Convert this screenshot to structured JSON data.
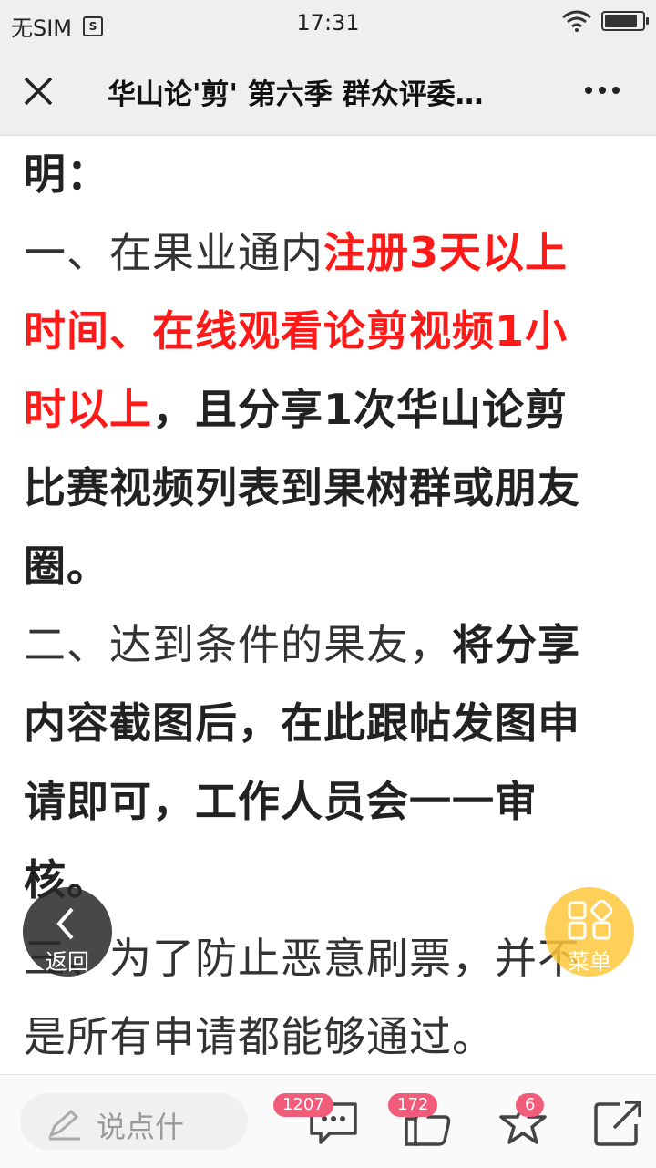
{
  "status_bar": {
    "carrier": "无SIM",
    "time": "17:31"
  },
  "nav": {
    "title": "华山论'剪' 第六季 群众评委…"
  },
  "article": {
    "lines": [
      [
        {
          "t": "明：",
          "s": "b"
        }
      ],
      [
        {
          "t": "一、在果业通内",
          "s": "n"
        },
        {
          "t": "注册3天以上",
          "s": "r"
        }
      ],
      [
        {
          "t": "时间、在线观看论剪视频1小",
          "s": "r"
        }
      ],
      [
        {
          "t": "时以上",
          "s": "r"
        },
        {
          "t": "，且分享1次华山论剪",
          "s": "b"
        }
      ],
      [
        {
          "t": "比赛视频列表到果树群或朋友",
          "s": "b"
        }
      ],
      [
        {
          "t": "圈。",
          "s": "b"
        }
      ],
      [
        {
          "t": "二、达到条件的果友，",
          "s": "n"
        },
        {
          "t": "将分享",
          "s": "b"
        }
      ],
      [
        {
          "t": "内容截图后，在此跟帖发图申",
          "s": "b"
        }
      ],
      [
        {
          "t": "请即可，工作人员会一一审",
          "s": "b"
        }
      ],
      [
        {
          "t": "核。",
          "s": "b"
        }
      ],
      [
        {
          "t": "三、为了防止恶意刷票，并不",
          "s": "n"
        }
      ],
      [
        {
          "t": "是所有申请都能够通过。",
          "s": "n"
        }
      ]
    ]
  },
  "floating": {
    "back_label": "返回",
    "menu_label": "菜单"
  },
  "bottom_bar": {
    "comment_placeholder": "说点什",
    "comments_count": "1207",
    "likes_count": "172",
    "favorites_count": "6"
  },
  "colors": {
    "highlight_red": "#ff1a1a",
    "badge_pink": "#f25c7b",
    "menu_yellow": "#ffc83c"
  }
}
